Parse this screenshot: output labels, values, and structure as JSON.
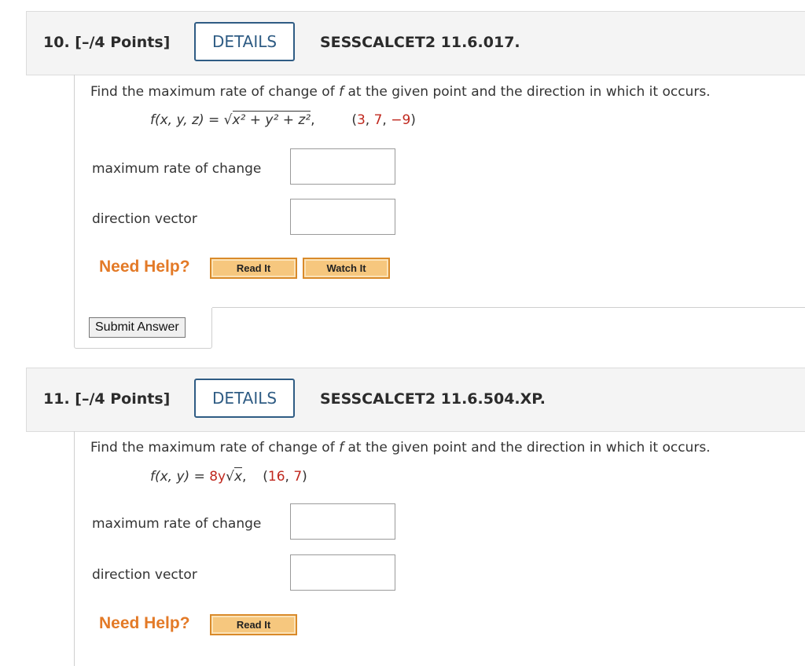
{
  "questions": [
    {
      "number_label": "10.  [–/4 Points]",
      "details_label": "DETAILS",
      "code": "SESSCALCET2 11.6.017.",
      "prompt_pre": "Find the maximum rate of change of ",
      "prompt_var": "f",
      "prompt_post": " at the given point and the direction in which it occurs.",
      "function_lhs": "f(x, y, z) = ",
      "function_under_root": "x² + y² + z²",
      "point_separator": ",",
      "point": "(3, 7, −9)",
      "field_labels": [
        "maximum rate of change",
        "direction vector"
      ],
      "need_help": "Need Help?",
      "help_buttons": [
        "Read It",
        "Watch It"
      ],
      "submit_label": "Submit Answer"
    },
    {
      "number_label": "11.  [–/4 Points]",
      "details_label": "DETAILS",
      "code": "SESSCALCET2 11.6.504.XP.",
      "prompt_pre": "Find the maximum rate of change of ",
      "prompt_var": "f",
      "prompt_post": " at the given point and the direction in which it occurs.",
      "function_lhs": "f(x, y) = ",
      "function_coef": "8y",
      "function_under_root": "x",
      "point_separator": ",",
      "point": "(16, 7)",
      "field_labels": [
        "maximum rate of change",
        "direction vector"
      ],
      "need_help": "Need Help?",
      "help_buttons": [
        "Read It"
      ]
    }
  ],
  "colors": {
    "details_border": "#2f5c84",
    "need_help": "#e37a27",
    "help_button_fill": "#f6c77e",
    "highlight_red": "#c0281e"
  },
  "icons": [
    "sqrt-sign-icon"
  ]
}
